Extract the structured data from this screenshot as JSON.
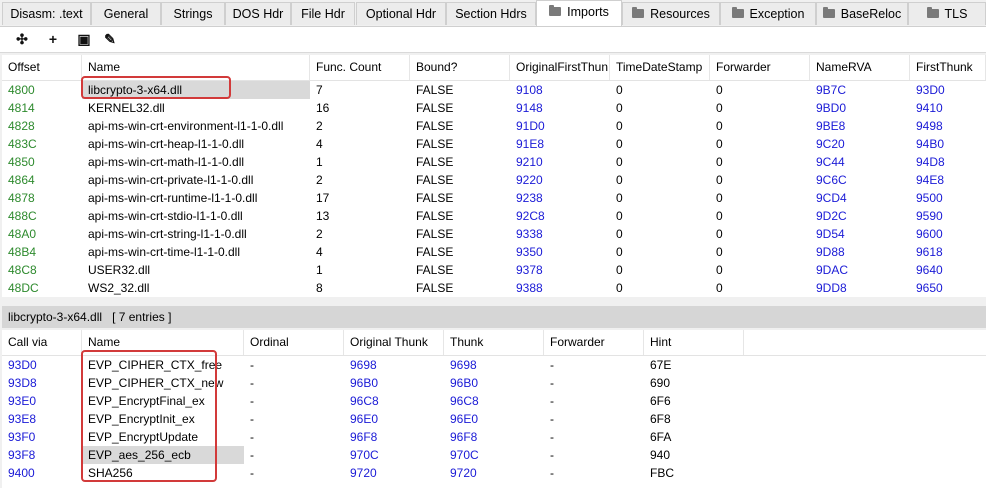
{
  "tabs": [
    {
      "label": "Disasm: .text",
      "folder": false
    },
    {
      "label": "General",
      "folder": false
    },
    {
      "label": "Strings",
      "folder": false
    },
    {
      "label": "DOS Hdr",
      "folder": false
    },
    {
      "label": "File Hdr",
      "folder": false
    },
    {
      "label": "Optional Hdr",
      "folder": false
    },
    {
      "label": "Section Hdrs",
      "folder": false
    },
    {
      "label": "Imports",
      "folder": true,
      "active": true
    },
    {
      "label": "Resources",
      "folder": true
    },
    {
      "label": "Exception",
      "folder": true
    },
    {
      "label": "BaseReloc",
      "folder": true
    },
    {
      "label": "TLS",
      "folder": true
    }
  ],
  "toolbar": {
    "icons": [
      "move-icon",
      "add-icon",
      "save-icon",
      "magic-wand-icon"
    ],
    "glyphs": [
      "✣",
      "+",
      "▣",
      "✎"
    ]
  },
  "imports": {
    "columns": [
      "Offset",
      "Name",
      "Func. Count",
      "Bound?",
      "OriginalFirstThun",
      "TimeDateStamp",
      "Forwarder",
      "NameRVA",
      "FirstThunk"
    ],
    "rows": [
      [
        "4800",
        "libcrypto-3-x64.dll",
        "7",
        "FALSE",
        "9108",
        "0",
        "0",
        "9B7C",
        "93D0"
      ],
      [
        "4814",
        "KERNEL32.dll",
        "16",
        "FALSE",
        "9148",
        "0",
        "0",
        "9BD0",
        "9410"
      ],
      [
        "4828",
        "api-ms-win-crt-environment-l1-1-0.dll",
        "2",
        "FALSE",
        "91D0",
        "0",
        "0",
        "9BE8",
        "9498"
      ],
      [
        "483C",
        "api-ms-win-crt-heap-l1-1-0.dll",
        "4",
        "FALSE",
        "91E8",
        "0",
        "0",
        "9C20",
        "94B0"
      ],
      [
        "4850",
        "api-ms-win-crt-math-l1-1-0.dll",
        "1",
        "FALSE",
        "9210",
        "0",
        "0",
        "9C44",
        "94D8"
      ],
      [
        "4864",
        "api-ms-win-crt-private-l1-1-0.dll",
        "2",
        "FALSE",
        "9220",
        "0",
        "0",
        "9C6C",
        "94E8"
      ],
      [
        "4878",
        "api-ms-win-crt-runtime-l1-1-0.dll",
        "17",
        "FALSE",
        "9238",
        "0",
        "0",
        "9CD4",
        "9500"
      ],
      [
        "488C",
        "api-ms-win-crt-stdio-l1-1-0.dll",
        "13",
        "FALSE",
        "92C8",
        "0",
        "0",
        "9D2C",
        "9590"
      ],
      [
        "48A0",
        "api-ms-win-crt-string-l1-1-0.dll",
        "2",
        "FALSE",
        "9338",
        "0",
        "0",
        "9D54",
        "9600"
      ],
      [
        "48B4",
        "api-ms-win-crt-time-l1-1-0.dll",
        "4",
        "FALSE",
        "9350",
        "0",
        "0",
        "9D88",
        "9618"
      ],
      [
        "48C8",
        "USER32.dll",
        "1",
        "FALSE",
        "9378",
        "0",
        "0",
        "9DAC",
        "9640"
      ],
      [
        "48DC",
        "WS2_32.dll",
        "8",
        "FALSE",
        "9388",
        "0",
        "0",
        "9DD8",
        "9650"
      ]
    ]
  },
  "selected_dll": {
    "name": "libcrypto-3-x64.dll",
    "entries": "[ 7 entries ]"
  },
  "functions": {
    "columns": [
      "Call via",
      "Name",
      "Ordinal",
      "Original Thunk",
      "Thunk",
      "Forwarder",
      "Hint"
    ],
    "rows": [
      [
        "93D0",
        "EVP_CIPHER_CTX_free",
        "-",
        "9698",
        "9698",
        "-",
        "67E"
      ],
      [
        "93D8",
        "EVP_CIPHER_CTX_new",
        "-",
        "96B0",
        "96B0",
        "-",
        "690"
      ],
      [
        "93E0",
        "EVP_EncryptFinal_ex",
        "-",
        "96C8",
        "96C8",
        "-",
        "6F6"
      ],
      [
        "93E8",
        "EVP_EncryptInit_ex",
        "-",
        "96E0",
        "96E0",
        "-",
        "6F8"
      ],
      [
        "93F0",
        "EVP_EncryptUpdate",
        "-",
        "96F8",
        "96F8",
        "-",
        "6FA"
      ],
      [
        "93F8",
        "EVP_aes_256_ecb",
        "-",
        "970C",
        "970C",
        "-",
        "940"
      ],
      [
        "9400",
        "SHA256",
        "-",
        "9720",
        "9720",
        "-",
        "FBC"
      ]
    ]
  },
  "colors": {
    "offset": "#2d8a2d",
    "address": "#1a1ad6",
    "highlight": "#d23a3a",
    "selected_row": "#d9d9d9"
  }
}
